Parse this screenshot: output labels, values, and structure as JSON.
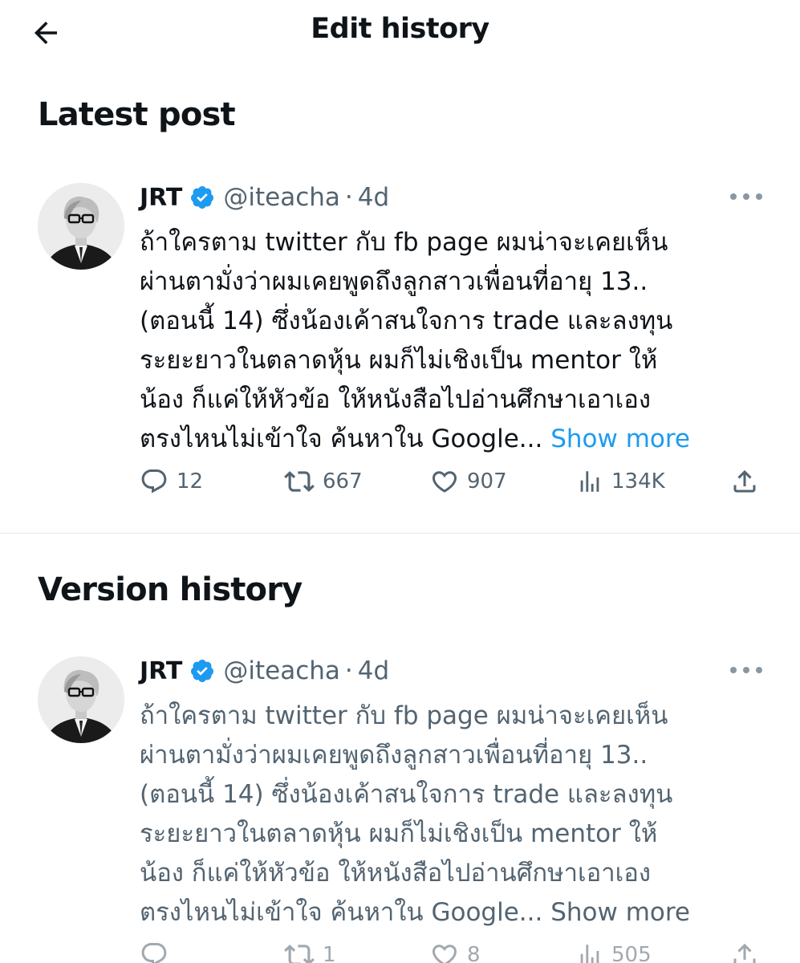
{
  "header": {
    "title": "Edit history",
    "back_icon": "arrow-left-icon"
  },
  "sections": {
    "latest_title": "Latest post",
    "version_title": "Version history"
  },
  "colors": {
    "link": "#1d9bf0",
    "verified": "#1d9bf0",
    "secondary_text": "#536471",
    "primary_text": "#0f1419"
  },
  "latest_post": {
    "name": "JRT",
    "handle": "@iteacha",
    "dot": "·",
    "time": "4d",
    "lines": [
      "ถ้าใครตาม twitter กับ fb page ผมน่าจะเคยเห็น",
      "ผ่านตามั่งว่าผมเคยพูดถึงลูกสาวเพื่อนที่อายุ 13..",
      "(ตอนนี้ 14) ซึ่งน้องเค้าสนใจการ trade และลงทุน",
      "ระยะยาวในตลาดหุ้น ผมก็ไม่เชิงเป็น mentor ให้",
      "น้อง ก็แค่ให้หัวข้อ  ให้หนังสือไปอ่านศึกษาเอาเอง",
      "ตรงไหนไม่เข้าใจ ค้นหาใน Google..."
    ],
    "show_more": "Show more",
    "replies": "12",
    "retweets": "667",
    "likes": "907",
    "views": "134K"
  },
  "version_post": {
    "name": "JRT",
    "handle": "@iteacha",
    "dot": "·",
    "time": "4d",
    "lines": [
      "ถ้าใครตาม twitter กับ fb page ผมน่าจะเคยเห็น",
      "ผ่านตามั่งว่าผมเคยพูดถึงลูกสาวเพื่อนที่อายุ 13..",
      "(ตอนนี้ 14) ซึ่งน้องเค้าสนใจการ trade และลงทุน",
      "ระยะยาวในตลาดหุ้น ผมก็ไม่เชิงเป็น mentor ให้",
      "น้อง ก็แค่ให้หัวข้อ  ให้หนังสือไปอ่านศึกษาเอาเอง",
      "ตรงไหนไม่เข้าใจ ค้นหาใน Google..."
    ],
    "show_more": "Show more",
    "replies": "",
    "retweets": "1",
    "likes": "8",
    "views": "505"
  }
}
